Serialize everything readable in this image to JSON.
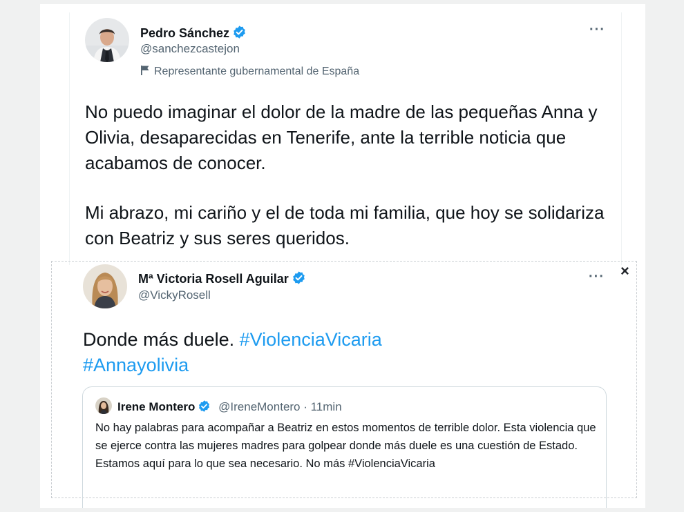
{
  "tweet_main": {
    "author_name": "Pedro Sánchez",
    "handle": "@sanchezcastejon",
    "label": "Representante gubernamental de España",
    "more": "···",
    "paragraph1": "No puedo imaginar el dolor de la madre de las pequeñas Anna y Olivia, desaparecidas en Tenerife, ante la terrible noticia que acabamos de conocer.",
    "paragraph2": "Mi abrazo, mi cariño y el de toda mi familia, que hoy se solidariza con Beatriz y sus seres queridos."
  },
  "tweet_second": {
    "author_name": "Mª Victoria Rosell Aguilar",
    "handle": "@VickyRosell",
    "more": "···",
    "close": "×",
    "text_plain": "Donde más duele. ",
    "hashtag1": "#ViolenciaVicaria",
    "hashtag2": "#Annayolivia"
  },
  "quoted_tweet": {
    "author_name": "Irene Montero",
    "handle_time": "@IreneMontero · 11min",
    "text": "No hay palabras para acompañar a Beatriz en estos momentos de terrible dolor. Esta violencia que se ejerce contra las mujeres madres para golpear donde más duele es una cuestión de Estado. Estamos aquí para lo que sea necesario. No más #ViolenciaVicaria"
  },
  "colors": {
    "link": "#1d9bf0",
    "verified": "#1d9bf0",
    "secondary_text": "#536471"
  },
  "icons": [
    "verified-badge-icon",
    "flag-icon",
    "more-options-icon",
    "close-icon"
  ]
}
